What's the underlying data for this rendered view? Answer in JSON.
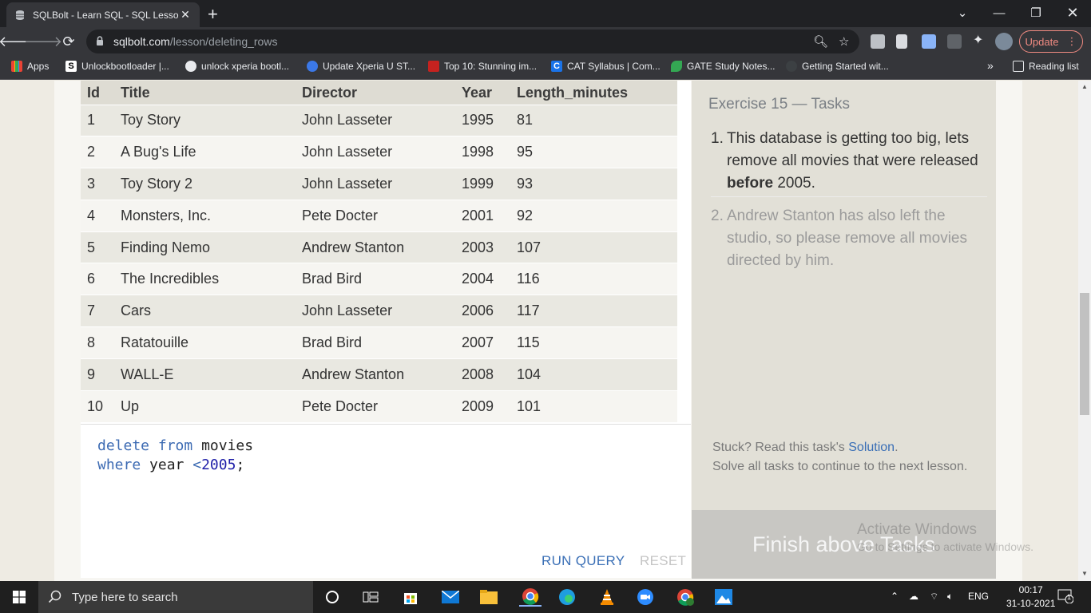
{
  "browser": {
    "tab_title": "SQLBolt - Learn SQL - SQL Lesson",
    "tab_close": "✕",
    "new_tab": "+",
    "url_domain": "sqlbolt.com",
    "url_path": "/lesson/deleting_rows",
    "update_label": "Update",
    "bookmarks": [
      {
        "label": "Apps"
      },
      {
        "label": "Unlockbootloader |..."
      },
      {
        "label": "unlock xperia bootl..."
      },
      {
        "label": "Update Xperia U ST..."
      },
      {
        "label": "Top 10: Stunning im..."
      },
      {
        "label": "CAT Syllabus | Com..."
      },
      {
        "label": "GATE Study Notes..."
      },
      {
        "label": "Getting Started wit..."
      }
    ],
    "more_bookmarks": "»",
    "reading_list": "Reading list"
  },
  "table": {
    "columns": [
      "Id",
      "Title",
      "Director",
      "Year",
      "Length_minutes"
    ],
    "rows": [
      [
        "1",
        "Toy Story",
        "John Lasseter",
        "1995",
        "81"
      ],
      [
        "2",
        "A Bug's Life",
        "John Lasseter",
        "1998",
        "95"
      ],
      [
        "3",
        "Toy Story 2",
        "John Lasseter",
        "1999",
        "93"
      ],
      [
        "4",
        "Monsters, Inc.",
        "Pete Docter",
        "2001",
        "92"
      ],
      [
        "5",
        "Finding Nemo",
        "Andrew Stanton",
        "2003",
        "107"
      ],
      [
        "6",
        "The Incredibles",
        "Brad Bird",
        "2004",
        "116"
      ],
      [
        "7",
        "Cars",
        "John Lasseter",
        "2006",
        "117"
      ],
      [
        "8",
        "Ratatouille",
        "Brad Bird",
        "2007",
        "115"
      ],
      [
        "9",
        "WALL-E",
        "Andrew Stanton",
        "2008",
        "104"
      ],
      [
        "10",
        "Up",
        "Pete Docter",
        "2009",
        "101"
      ]
    ]
  },
  "editor": {
    "line1_kw1": "delete",
    "line1_kw2": "from",
    "line1_rest": "movies",
    "line2_kw": "where",
    "line2_mid": "year",
    "line2_op": "<",
    "line2_num": "2005",
    "line2_end": ";",
    "run_label": "RUN QUERY",
    "reset_label": "RESET"
  },
  "tasks": {
    "title": "Exercise 15 — Tasks",
    "task1_num": "1.",
    "task1_pre": "This database is getting too big, lets remove all movies that were released",
    "task1_bold": "before",
    "task1_post": "2005.",
    "task2_num": "2.",
    "task2_text": "Andrew Stanton has also left the studio, so please remove all movies directed by him.",
    "stuck_pre": "Stuck? Read this task's",
    "stuck_link": "Solution",
    "stuck_post": ".",
    "solve_text": "Solve all tasks to continue to the next lesson.",
    "finish_label": "Finish above Tasks"
  },
  "watermark": {
    "line1": "Activate Windows",
    "line2": "Go to Settings to activate Windows."
  },
  "taskbar": {
    "search_placeholder": "Type here to search",
    "language": "ENG",
    "time": "00:17",
    "date": "31-10-2021",
    "notification_count": "1"
  }
}
